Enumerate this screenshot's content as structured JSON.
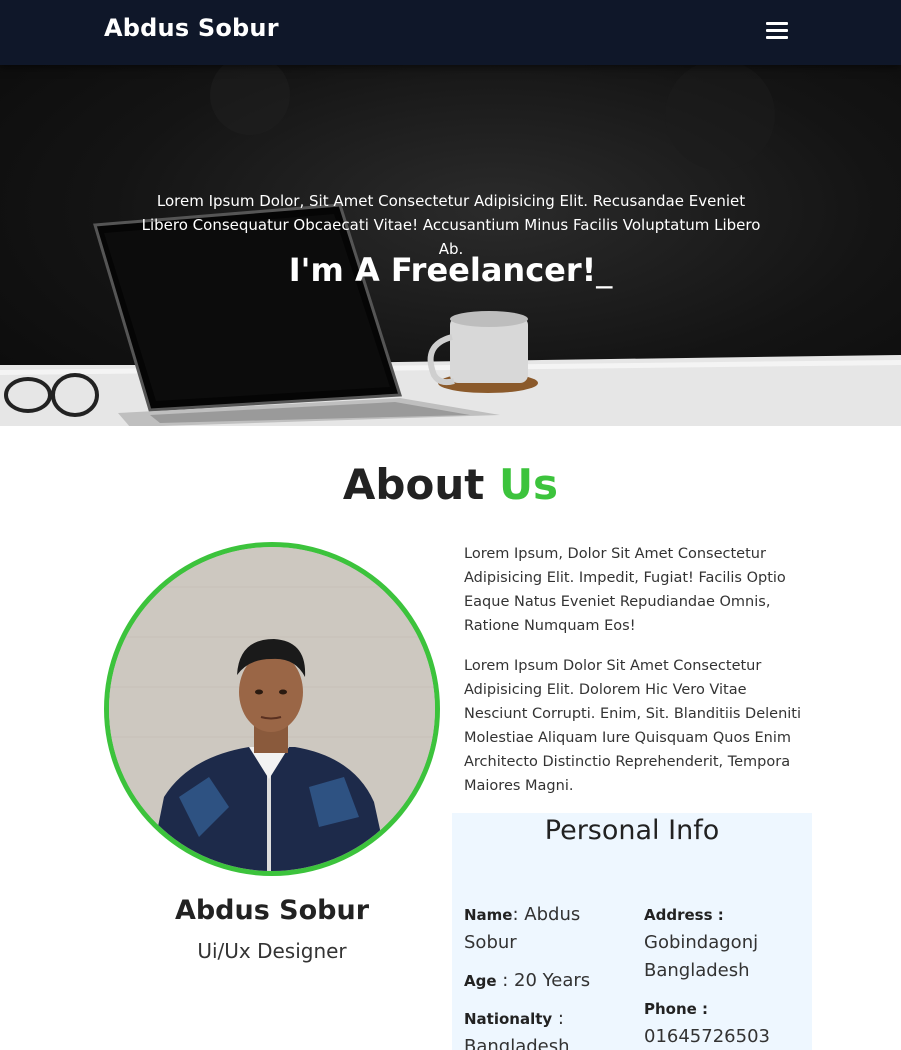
{
  "nav": {
    "brand": "Abdus Sobur",
    "menu_icon": "hamburger-menu-icon"
  },
  "hero": {
    "text": "Lorem Ipsum Dolor, Sit Amet Consectetur Adipisicing Elit. Recusandae Eveniet Libero Consequatur Obcaecati Vitae! Accusantium Minus Facilis Voluptatum Libero Ab.",
    "heading": "I'm A Freelancer!",
    "caret": "_"
  },
  "about": {
    "title_main": "About",
    "title_accent": "Us",
    "accent_color": "#3cc33c",
    "paragraph1": "Lorem Ipsum, Dolor Sit Amet Consectetur Adipisicing Elit. Impedit, Fugiat! Facilis Optio Eaque Natus Eveniet Repudiandae Omnis, Ratione Numquam Eos!",
    "paragraph2": "Lorem Ipsum Dolor Sit Amet Consectetur Adipisicing Elit. Dolorem Hic Vero Vitae Nesciunt Corrupti. Enim, Sit. Blanditiis Deleniti Molestiae Aliquam Iure Quisquam Quos Enim Architecto Distinctio Reprehenderit, Tempora Maiores Magni."
  },
  "profile": {
    "name": "Abdus Sobur",
    "role": "Ui/Ux Designer"
  },
  "personal_info": {
    "title": "Personal Info",
    "name_label": "Name",
    "name_sep": ":",
    "name_value": " Abdus Sobur",
    "age_label": "Age",
    "age_value": " : 20 Years",
    "nationality_label": "Nationalty",
    "nationality_value": " : Bangladesh",
    "address_label": "Address :",
    "address_value": "Gobindagonj Bangladesh",
    "phone_label": "Phone :",
    "phone_value": "01645726503"
  }
}
